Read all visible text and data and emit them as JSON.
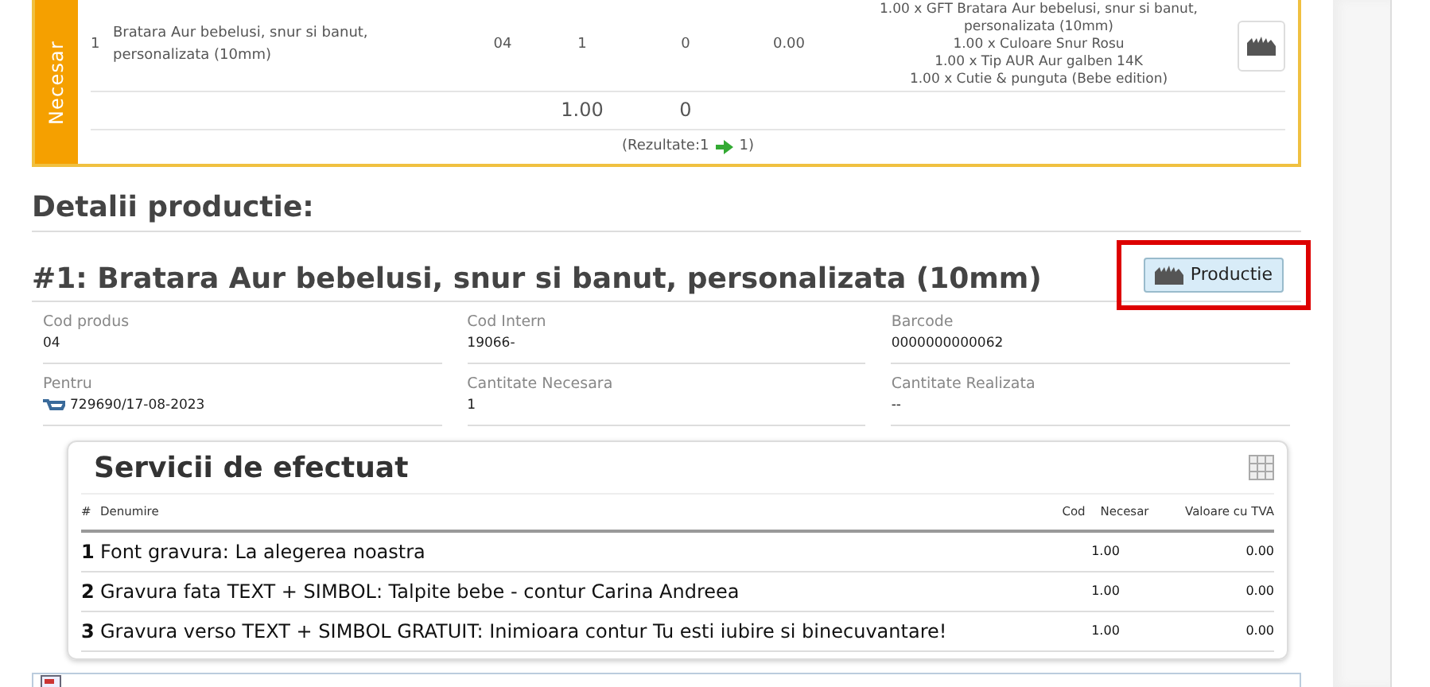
{
  "top_table": {
    "side_label": "Necesar",
    "rows": [
      {
        "number": "1",
        "name": "Bratara Aur bebelusi, snur si banut, personalizata (10mm)",
        "code": "04",
        "qty": "1",
        "done": "0",
        "value": "0.00",
        "details": [
          "1.00 x GFT Bratara Aur bebelusi, snur si banut, personalizata (10mm)",
          "1.00 x Culoare Snur Rosu",
          "1.00 x Tip AUR Aur galben 14K",
          "1.00 x Cutie & punguta (Bebe edition)"
        ]
      }
    ],
    "totals": {
      "qty": "1.00",
      "done": "0"
    },
    "pagination": {
      "before": "(Rezultate:1",
      "after": "1)"
    }
  },
  "section_title": "Detalii productie:",
  "product": {
    "title": "#1: Bratara Aur bebelusi, snur si banut, personalizata (10mm)",
    "button": "Productie",
    "highlighted": true
  },
  "fields": [
    {
      "kind": "text",
      "label": "Cod produs",
      "value": "04"
    },
    {
      "kind": "text",
      "label": "Cod Intern",
      "value": "19066-"
    },
    {
      "kind": "text",
      "label": "Barcode",
      "value": "0000000000062"
    },
    {
      "kind": "order",
      "label": "Pentru",
      "value": "729690/17-08-2023"
    },
    {
      "kind": "text",
      "label": "Cantitate Necesara",
      "value": "1"
    },
    {
      "kind": "text",
      "label": "Cantitate Realizata",
      "value": "--"
    }
  ],
  "services": {
    "title": "Servicii de efectuat",
    "columns": [
      "#",
      "Denumire",
      "Cod",
      "Necesar",
      "Valoare cu TVA"
    ],
    "rows": [
      {
        "number": "1",
        "name": "Font gravura: La alegerea noastra",
        "qty": "1.00",
        "value": "0.00"
      },
      {
        "number": "2",
        "name": "Gravura fata TEXT + SIMBOL: Talpite bebe - contur Carina Andreea",
        "qty": "1.00",
        "value": "0.00"
      },
      {
        "number": "3",
        "name": "Gravura verso TEXT + SIMBOL GRATUIT: Inimioara contur Tu esti iubire si binecuvantare!",
        "qty": "1.00",
        "value": "0.00"
      }
    ]
  }
}
